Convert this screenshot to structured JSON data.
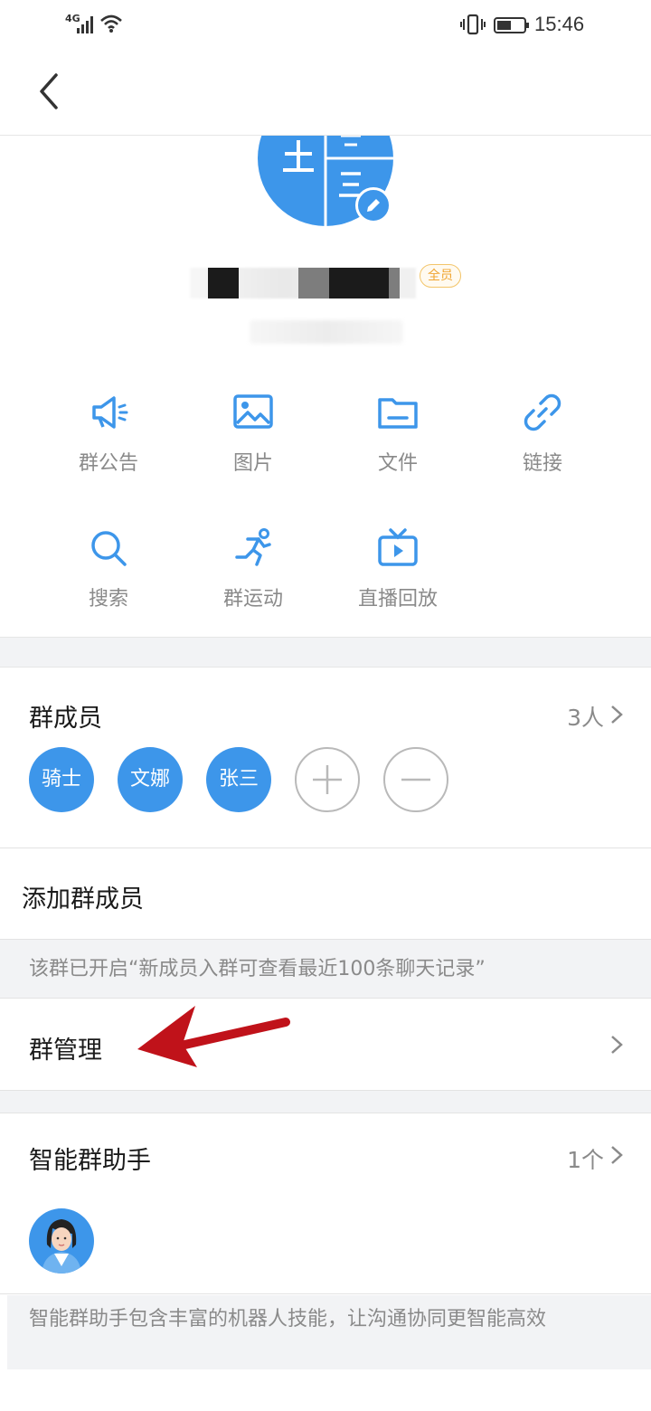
{
  "status_bar": {
    "network": "4G",
    "time": "15:46",
    "icons": [
      "signal-icon",
      "wifi-icon",
      "vibrate-icon",
      "battery-icon"
    ]
  },
  "nav": {
    "back_icon": "chevron-left-icon"
  },
  "group": {
    "all_members_badge": "全员",
    "edit_icon": "pencil-icon"
  },
  "functions": [
    {
      "label": "群公告",
      "icon": "megaphone-icon"
    },
    {
      "label": "图片",
      "icon": "image-icon"
    },
    {
      "label": "文件",
      "icon": "folder-icon"
    },
    {
      "label": "链接",
      "icon": "link-icon"
    },
    {
      "label": "搜索",
      "icon": "search-icon"
    },
    {
      "label": "群运动",
      "icon": "running-icon"
    },
    {
      "label": "直播回放",
      "icon": "tv-play-icon"
    }
  ],
  "members": {
    "title": "群成员",
    "count": "3人",
    "list": [
      "骑士",
      "文娜",
      "张三"
    ]
  },
  "add_member": {
    "label": "添加群成员"
  },
  "history_notice": "该群已开启“新成员入群可查看最近100条聊天记录”",
  "group_manage": {
    "label": "群管理"
  },
  "assistant": {
    "title": "智能群助手",
    "count": "1个",
    "description": "智能群助手包含丰富的机器人技能，让沟通协同更智能高效"
  },
  "colors": {
    "accent": "#3d96ea",
    "badge_orange": "#f0a530",
    "annotation_arrow": "#c0121a",
    "section_gap": "#f2f3f5"
  }
}
